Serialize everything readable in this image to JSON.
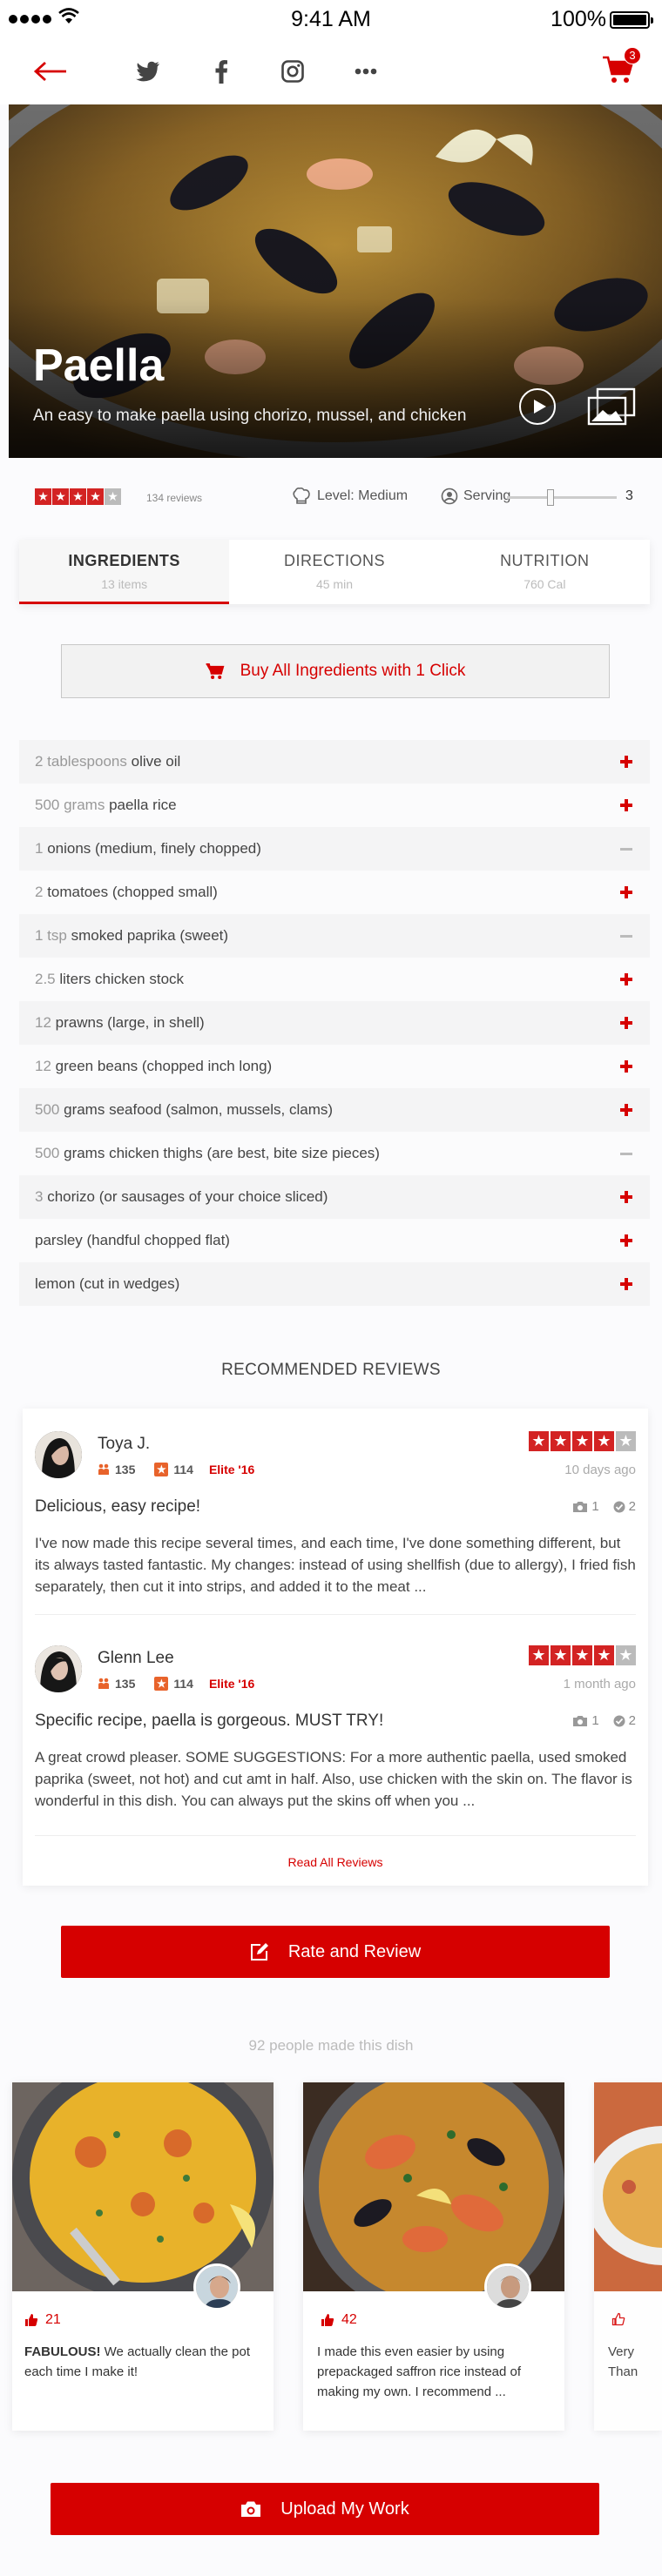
{
  "status_bar": {
    "time": "9:41 AM",
    "battery": "100%"
  },
  "nav": {
    "cart_count": "3"
  },
  "hero": {
    "title": "Paella",
    "subtitle": "An easy to make paella using chorizo, mussel, and chicken"
  },
  "meta": {
    "rating": 4,
    "reviews": "134 reviews",
    "level": "Level: Medium",
    "serving_label": "Serving",
    "serving_value": "3",
    "serving_slider_fraction": 0.4
  },
  "tabs": [
    {
      "label": "INGREDIENTS",
      "sub": "13 items"
    },
    {
      "label": "DIRECTIONS",
      "sub": "45 min"
    },
    {
      "label": "NUTRITION",
      "sub": "760 Cal"
    }
  ],
  "buy_all_label": "Buy All Ingredients with 1 Click",
  "ingredients": [
    {
      "qty": "2 tablespoons",
      "name": "olive oil",
      "state": "plus"
    },
    {
      "qty": "500 grams",
      "name": "paella rice",
      "state": "plus"
    },
    {
      "qty": "1",
      "name": "onions (medium, finely chopped)",
      "state": "minus"
    },
    {
      "qty": "2",
      "name": "tomatoes (chopped small)",
      "state": "plus"
    },
    {
      "qty": "1 tsp",
      "name": "smoked paprika (sweet)",
      "state": "minus"
    },
    {
      "qty": "2.5",
      "name": "liters chicken stock",
      "state": "plus"
    },
    {
      "qty": "12",
      "name": "prawns (large, in shell)",
      "state": "plus"
    },
    {
      "qty": "12",
      "name": "green beans (chopped inch long)",
      "state": "plus"
    },
    {
      "qty": "500",
      "name": "grams seafood (salmon, mussels, clams)",
      "state": "plus"
    },
    {
      "qty": "500",
      "name": "grams chicken thighs (are best, bite size pieces)",
      "state": "minus"
    },
    {
      "qty": "3",
      "name": "chorizo (or sausages of your choice sliced)",
      "state": "plus"
    },
    {
      "qty": "",
      "name": "parsley (handful chopped flat)",
      "state": "plus"
    },
    {
      "qty": "",
      "name": "lemon (cut in wedges)",
      "state": "plus"
    }
  ],
  "reviews_title": "RECOMMENDED REVIEWS",
  "reviews": [
    {
      "name": "Toya J.",
      "friends": "135",
      "review_count": "114",
      "elite": "Elite '16",
      "rating": 4,
      "date": "10 days ago",
      "headline": "Delicious, easy recipe!",
      "photos": "1",
      "checkins": "2",
      "body": "I've now made this recipe several times, and each time, I've done something different, but its always tasted fantastic. My changes: instead of using shellfish (due to allergy), I fried fish separately, then cut it into strips, and added it to the meat ..."
    },
    {
      "name": "Glenn Lee",
      "friends": "135",
      "review_count": "114",
      "elite": "Elite '16",
      "rating": 4,
      "date": "1 month ago",
      "headline": "Specific recipe, paella is gorgeous. MUST TRY!",
      "photos": "1",
      "checkins": "2",
      "body": "A great crowd pleaser. SOME SUGGESTIONS: For a more authentic paella, used smoked paprika (sweet, not hot) and cut amt in half. Also, use chicken with the skin on. The flavor is wonderful in this dish. You can always put the skins off when you ..."
    }
  ],
  "read_all_label": "Read All Reviews",
  "rate_review_label": "Rate and Review",
  "made_count_text": "92 people made this dish",
  "made_cards": [
    {
      "likes": "21",
      "text_bold": "FABULOUS!",
      "text": " We actually clean the pot each time I make it!"
    },
    {
      "likes": "42",
      "text_bold": "",
      "text": "I made this even easier by using prepackaged saffron rice instead of making my own. I recommend ..."
    },
    {
      "likes": "",
      "text_bold": "",
      "text": "Very Than"
    }
  ],
  "upload_label": "Upload My Work",
  "colors": {
    "accent": "#d60000",
    "star": "#d32323"
  }
}
